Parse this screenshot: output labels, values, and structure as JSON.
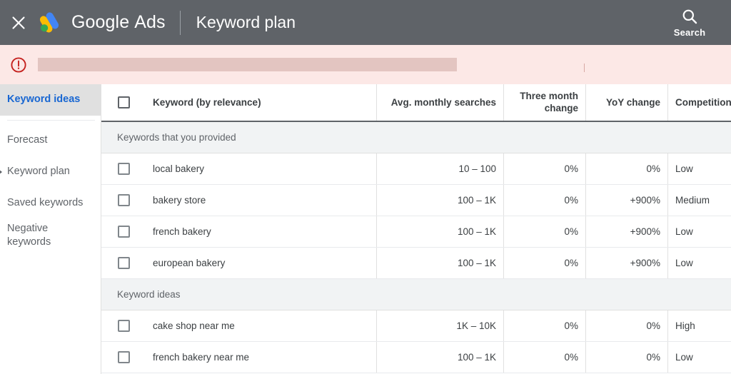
{
  "appbar": {
    "close_icon": "close-icon",
    "logo_icon": "google-ads-logo",
    "brand_google": "Google",
    "brand_ads": "Ads",
    "page_title": "Keyword plan",
    "search_icon": "search-icon",
    "search_label": "Search"
  },
  "banner": {
    "icon": "error-icon",
    "message": "",
    "bg_color": "#fce8e6",
    "icon_color": "#c5221f"
  },
  "sidebar": {
    "items": [
      {
        "label": "Keyword ideas",
        "selected": true,
        "caret": false
      },
      {
        "label": "Forecast",
        "selected": false,
        "caret": false
      },
      {
        "label": "Keyword plan",
        "selected": false,
        "caret": true
      },
      {
        "label": "Saved keywords",
        "selected": false,
        "caret": false
      },
      {
        "label": "Negative keywords",
        "selected": false,
        "caret": false
      }
    ]
  },
  "table": {
    "columns": {
      "keyword": "Keyword (by relevance)",
      "avg_monthly_searches": "Avg. monthly searches",
      "three_month_change_line1": "Three month",
      "three_month_change_line2": "change",
      "yoy_change": "YoY change",
      "competition": "Competition"
    },
    "sections": [
      {
        "title": "Keywords that you provided",
        "rows": [
          {
            "keyword": "local bakery",
            "avg": "10 – 100",
            "three_month": "0%",
            "yoy": "0%",
            "competition": "Low"
          },
          {
            "keyword": "bakery store",
            "avg": "100 – 1K",
            "three_month": "0%",
            "yoy": "+900%",
            "competition": "Medium"
          },
          {
            "keyword": "french bakery",
            "avg": "100 – 1K",
            "three_month": "0%",
            "yoy": "+900%",
            "competition": "Low"
          },
          {
            "keyword": "european bakery",
            "avg": "100 – 1K",
            "three_month": "0%",
            "yoy": "+900%",
            "competition": "Low"
          }
        ]
      },
      {
        "title": "Keyword ideas",
        "rows": [
          {
            "keyword": "cake shop near me",
            "avg": "1K – 10K",
            "three_month": "0%",
            "yoy": "0%",
            "competition": "High"
          },
          {
            "keyword": "french bakery near me",
            "avg": "100 – 1K",
            "three_month": "0%",
            "yoy": "0%",
            "competition": "Low"
          }
        ]
      }
    ]
  },
  "colors": {
    "appbar_bg": "#5f6368",
    "accent_blue": "#1967d2",
    "logo_blue": "#4285f4",
    "logo_yellow": "#fbbc04",
    "logo_green": "#34a853",
    "section_bg": "#f1f3f4"
  }
}
